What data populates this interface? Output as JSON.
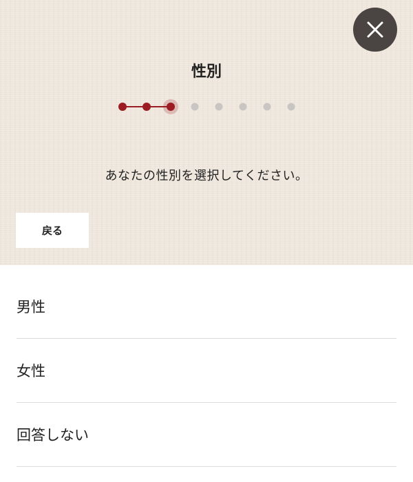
{
  "header": {
    "title": "性別",
    "close_icon": "close-icon"
  },
  "progress": {
    "total_steps": 8,
    "current_step": 3,
    "active_color": "#9b1c22",
    "inactive_color": "#c9c5c3"
  },
  "instruction": "あなたの性別を選択してください。",
  "back_button": {
    "label": "戻る"
  },
  "options": [
    {
      "label": "男性"
    },
    {
      "label": "女性"
    },
    {
      "label": "回答しない"
    }
  ],
  "colors": {
    "background_texture": "#efe7dd",
    "close_button": "#4a4542",
    "divider": "#dcdcdc"
  }
}
